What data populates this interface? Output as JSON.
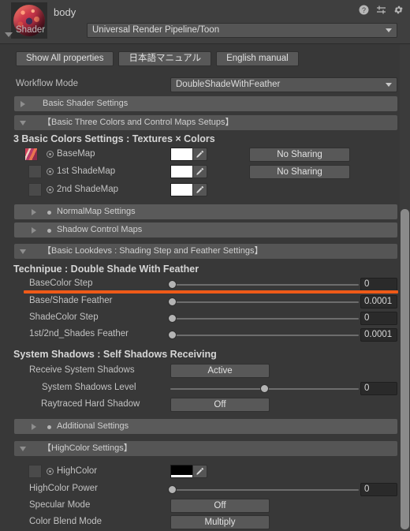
{
  "header": {
    "material_name": "body",
    "shader_label": "Shader",
    "shader_value": "Universal Render Pipeline/Toon",
    "icons": [
      "help-icon",
      "preset-icon",
      "gear-icon"
    ]
  },
  "toolbar": {
    "show_all_properties": "Show All properties",
    "japanese_manual": "日本語マニュアル",
    "english_manual": "English manual"
  },
  "workflow": {
    "label": "Workflow Mode",
    "value": "DoubleShadeWithFeather"
  },
  "sections": {
    "basic_shader_settings": "Basic Shader Settings",
    "basic_three_colors": "【Basic Three Colors and Control Maps Setups】",
    "normalmap_settings": "NormalMap Settings",
    "shadow_control_maps": "Shadow Control Maps",
    "basic_lookdevs": "【Basic Lookdevs : Shading Step and Feather Settings】",
    "additional_settings": "Additional Settings",
    "highcolor_settings": "【HighColor Settings】"
  },
  "three_colors": {
    "title": "3 Basic Colors Settings : Textures × Colors",
    "rows": [
      {
        "label": "BaseMap",
        "has_texture": true,
        "color": "#ffffff",
        "sharing": "No Sharing"
      },
      {
        "label": "1st ShadeMap",
        "has_texture": false,
        "color": "#ffffff",
        "sharing": "No Sharing"
      },
      {
        "label": "2nd ShadeMap",
        "has_texture": false,
        "color": "#ffffff",
        "sharing": ""
      }
    ]
  },
  "technique": {
    "title": "Technipue : Double Shade With Feather",
    "highlight_color": "#ef5a18",
    "sliders": [
      {
        "label": "BaseColor Step",
        "value": "0",
        "fill": 0.0,
        "highlighted": true
      },
      {
        "label": "Base/Shade Feather",
        "value": "0.0001",
        "fill": 0.0,
        "highlighted": false
      },
      {
        "label": "ShadeColor Step",
        "value": "0",
        "fill": 0.0,
        "highlighted": false
      },
      {
        "label": "1st/2nd_Shades Feather",
        "value": "0.0001",
        "fill": 0.0,
        "highlighted": false
      }
    ]
  },
  "system_shadows": {
    "title": "System Shadows : Self Shadows Receiving",
    "receive_label": "Receive System Shadows",
    "receive_value": "Active",
    "level_label": "System Shadows Level",
    "level_value": "0",
    "level_fill": 0.5,
    "raytraced_label": "Raytraced Hard Shadow",
    "raytraced_value": "Off"
  },
  "highcolor": {
    "color_label": "HighColor",
    "color_value": "#000000",
    "power_label": "HighColor Power",
    "power_value": "0",
    "power_fill": 0.0,
    "specular_label": "Specular Mode",
    "specular_value": "Off",
    "blend_label": "Color Blend Mode",
    "blend_value": "Multiply"
  }
}
